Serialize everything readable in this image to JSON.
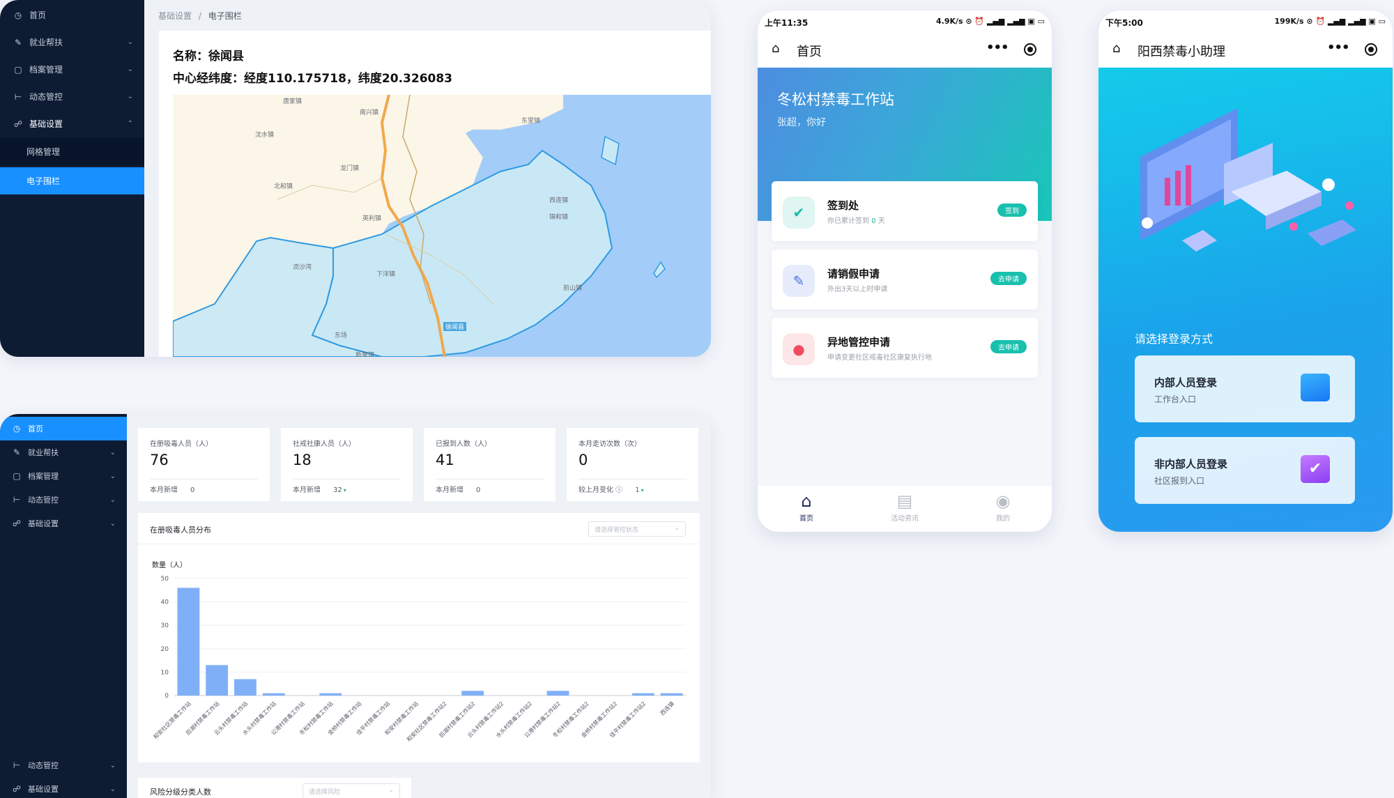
{
  "map_panel": {
    "sidebar": [
      {
        "icon": "dashboard-icon",
        "glyph": "◷",
        "label": "首页",
        "chev": ""
      },
      {
        "icon": "edit-icon",
        "glyph": "✎",
        "label": "就业帮扶",
        "chev": "⌄"
      },
      {
        "icon": "document-icon",
        "glyph": "▢",
        "label": "档案管理",
        "chev": "⌄"
      },
      {
        "icon": "control-icon",
        "glyph": "⊢",
        "label": "动态管控",
        "chev": "⌄"
      },
      {
        "icon": "settings-tree-icon",
        "glyph": "☍",
        "label": "基础设置",
        "chev": "⌃"
      }
    ],
    "sub_items": [
      "网格管理",
      "电子围栏"
    ],
    "breadcrumb": {
      "parent": "基础设置",
      "sep": "/",
      "current": "电子围栏"
    },
    "name_line": "名称：徐闻县",
    "coords_line": "中心经纬度：经度110.175718，纬度20.326083",
    "map_labels": [
      "唐家镇",
      "南兴镇",
      "东里镇",
      "北和镇",
      "沈水镇",
      "龙门镇",
      "英利镇",
      "前山镇",
      "锦和镇",
      "流沙湾",
      "下洋镇",
      "西连镇",
      "徐闻县",
      "东场",
      "新寮镇"
    ]
  },
  "dash_panel": {
    "sidebar": [
      {
        "icon": "dashboard-icon",
        "glyph": "◷",
        "label": "首页",
        "chev": ""
      },
      {
        "icon": "edit-icon",
        "glyph": "✎",
        "label": "就业帮扶",
        "chev": "⌄"
      },
      {
        "icon": "document-icon",
        "glyph": "▢",
        "label": "档案管理",
        "chev": "⌄"
      },
      {
        "icon": "control-icon",
        "glyph": "⊢",
        "label": "动态管控",
        "chev": "⌄"
      },
      {
        "icon": "settings-tree-icon",
        "glyph": "☍",
        "label": "基础设置",
        "chev": "⌄"
      }
    ],
    "sidebar_bottom": [
      {
        "icon": "control-icon",
        "glyph": "⊢",
        "label": "动态管控",
        "chev": "⌄"
      },
      {
        "icon": "settings-tree-icon",
        "glyph": "☍",
        "label": "基础设置",
        "chev": "⌄"
      }
    ],
    "stats": [
      {
        "label": "在册吸毒人员（人）",
        "value": "76",
        "sub_label": "本月新增",
        "sub_value": "0",
        "trend": ""
      },
      {
        "label": "社戒社康人员（人）",
        "value": "18",
        "sub_label": "本月新增",
        "sub_value": "32",
        "trend": "▾"
      },
      {
        "label": "已报到人数（人）",
        "value": "41",
        "sub_label": "本月新增",
        "sub_value": "0",
        "trend": ""
      },
      {
        "label": "本月走访次数（次）",
        "value": "0",
        "sub_label": "较上月变化 ⓘ",
        "sub_value": "1",
        "trend": "▾"
      }
    ],
    "chart_title": "在册吸毒人员分布",
    "chart_filter_placeholder": "请选择管控状态",
    "chart_filter_arrow": "⌄",
    "risk_title": "风险分级分类人数",
    "risk_filter_placeholder": "请选择风险",
    "risk_filter_arrow": "⌄"
  },
  "chart_data": {
    "type": "bar",
    "ylabel": "数量（人）",
    "ylim": [
      0,
      50
    ],
    "yticks": [
      0,
      10,
      20,
      30,
      40,
      50
    ],
    "grid": true,
    "bar_color": "#7fb0f7",
    "categories": [
      "和安社区禁毒工作站",
      "后湖村禁毒工作站",
      "云头村禁毒工作站",
      "水头村禁毒工作站",
      "公港村禁毒工作站",
      "冬松村禁毒工作站",
      "金桥村禁毒工作站",
      "佳平村禁毒工作站",
      "和安村禁毒工作站",
      "和安社区禁毒工作站2",
      "后湖村禁毒工作站2",
      "云头村禁毒工作站2",
      "水头村禁毒工作站2",
      "公港村禁毒工作站2",
      "冬松村禁毒工作站2",
      "金桥村禁毒工作站2",
      "佳平村禁毒工作站2",
      "西连镇"
    ],
    "values": [
      46,
      13,
      7,
      1,
      0,
      1,
      0,
      0,
      0,
      0,
      2,
      0,
      0,
      2,
      0,
      0,
      1,
      1
    ]
  },
  "phone1": {
    "status_time": "上午11:35",
    "status_right": "4.9K/s ⊙ ⏰ ▂▄▆ ▂▄▆ ▣ ▭",
    "nav_title": "首页",
    "nav_dots": "•••",
    "hero_title": "冬松村禁毒工作站",
    "hero_sub": "张超，你好",
    "entries": [
      {
        "icon": "calendar-check-icon",
        "glyph": "✔",
        "title": "签到处",
        "desc_pre": "你已累计签到",
        "desc_hl": "0",
        "desc_post": "天",
        "button": "签到"
      },
      {
        "icon": "edit-square-icon",
        "glyph": "✎",
        "title": "请销假申请",
        "desc_pre": "外出3天以上时申请",
        "desc_hl": "",
        "desc_post": "",
        "button": "去申请"
      },
      {
        "icon": "location-pin-icon",
        "glyph": "●",
        "title": "异地管控申请",
        "desc_pre": "申请变更社区戒毒社区康复执行地",
        "desc_hl": "",
        "desc_post": "",
        "button": "去申请"
      }
    ],
    "tabs": [
      {
        "icon": "home-icon",
        "glyph": "⌂",
        "label": "首页"
      },
      {
        "icon": "news-icon",
        "glyph": "▤",
        "label": "活动资讯"
      },
      {
        "icon": "user-icon",
        "glyph": "◉",
        "label": "我的"
      }
    ]
  },
  "phone2": {
    "status_time": "下午5:00",
    "status_right": "199K/s ⊙ ⏰ ▂▄▆ ▂▄▆ ▣ ▭",
    "nav_title": "阳西禁毒小助理",
    "nav_dots": "•••",
    "choose_text": "请选择登录方式",
    "logins": [
      {
        "title": "内部人员登录",
        "sub": "工作台入口",
        "icon": "folder-icon"
      },
      {
        "title": "非内部人员登录",
        "sub": "社区报到入口",
        "icon": "calendar-check-icon"
      }
    ]
  }
}
